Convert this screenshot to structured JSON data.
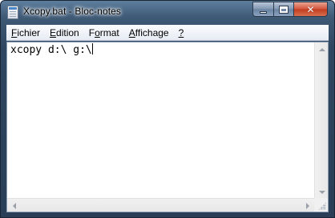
{
  "window": {
    "title": "Xcopy.bat - Bloc-notes",
    "icon": "notepad-icon",
    "colors": {
      "frame": "#3f5a76",
      "close_button": "#c13b1f"
    }
  },
  "caption_buttons": {
    "minimize_icon": "minimize-icon",
    "maximize_icon": "maximize-icon",
    "close_icon": "close-icon",
    "close_glyph": "✕"
  },
  "menu": {
    "items": [
      {
        "access_key": "F",
        "rest": "ichier"
      },
      {
        "access_key": "E",
        "rest": "dition"
      },
      {
        "pre": "F",
        "access_key": "o",
        "rest": "rmat"
      },
      {
        "access_key": "A",
        "rest": "ffichage"
      },
      {
        "access_key": "?",
        "rest": ""
      }
    ]
  },
  "editor": {
    "content": "xcopy d:\\ g:\\"
  }
}
